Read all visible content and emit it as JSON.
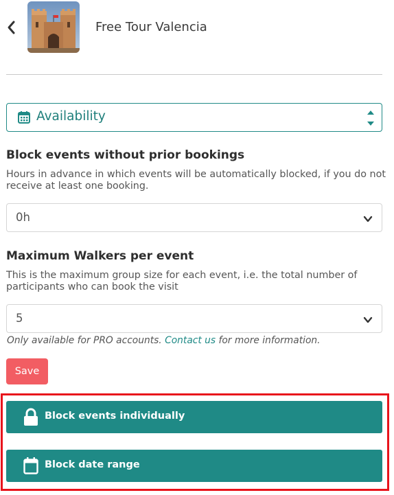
{
  "header": {
    "title": "Free Tour Valencia",
    "back_icon": "chevron-left-icon",
    "thumbnail": "tower-photo"
  },
  "section_select": {
    "value": "Availability",
    "icon": "calendar-icon"
  },
  "block_without_bookings": {
    "heading": "Block events without prior bookings",
    "description": "Hours in advance in which events will be automatically blocked, if you do not receive at least one booking.",
    "selected": "0h"
  },
  "max_walkers": {
    "heading": "Maximum Walkers per event",
    "description": "This is the maximum group size for each event, i.e. the total number of participants who can book the visit",
    "selected": "5",
    "note_before": "Only available for PRO accounts. ",
    "note_link": "Contact us",
    "note_after": " for more information."
  },
  "save_label": "Save",
  "actions": {
    "block_individually": "Block events individually",
    "block_date_range": "Block date range"
  },
  "colors": {
    "teal": "#1f8a86",
    "save": "#f25d63",
    "highlight": "#e8131b"
  }
}
